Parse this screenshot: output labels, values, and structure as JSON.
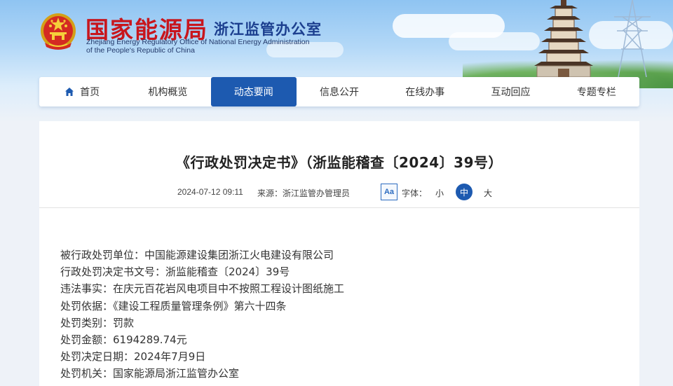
{
  "site": {
    "org_name": "国家能源局",
    "office_name": "浙江监管办公室",
    "english_name_line1": "Zhejiang Energy Regulatory Office of National Energy Administration",
    "english_name_line2": "of the People's Republic of China"
  },
  "nav": {
    "items": [
      {
        "label": "首页",
        "icon": "home-icon",
        "active": false
      },
      {
        "label": "机构概览",
        "active": false
      },
      {
        "label": "动态要闻",
        "active": true
      },
      {
        "label": "信息公开",
        "active": false
      },
      {
        "label": "在线办事",
        "active": false
      },
      {
        "label": "互动回应",
        "active": false
      },
      {
        "label": "专题专栏",
        "active": false
      }
    ]
  },
  "article": {
    "title": "《行政处罚决定书》（浙监能稽查〔2024〕39号）",
    "date": "2024-07-12 09:11",
    "source": "来源：浙江监管办管理员",
    "font_size_toggle": "Aa",
    "font_size_label": "字体：",
    "font_small": "小",
    "font_medium": "中",
    "font_large": "大",
    "font_selected": "中",
    "lines": [
      "被行政处罚单位：中国能源建设集团浙江火电建设有限公司",
      "行政处罚决定书文号：浙监能稽查〔2024〕39号",
      "违法事实：在庆元百花岩风电项目中不按照工程设计图纸施工",
      "处罚依据：《建设工程质量管理条例》第六十四条",
      "处罚类别：罚款",
      "处罚金额：6194289.74元",
      "处罚决定日期：2024年7月9日",
      "处罚机关：国家能源局浙江监管办公室"
    ]
  },
  "colors": {
    "brand_red": "#c8161d",
    "brand_blue": "#1c3f8f",
    "nav_active": "#1d5ab0"
  }
}
